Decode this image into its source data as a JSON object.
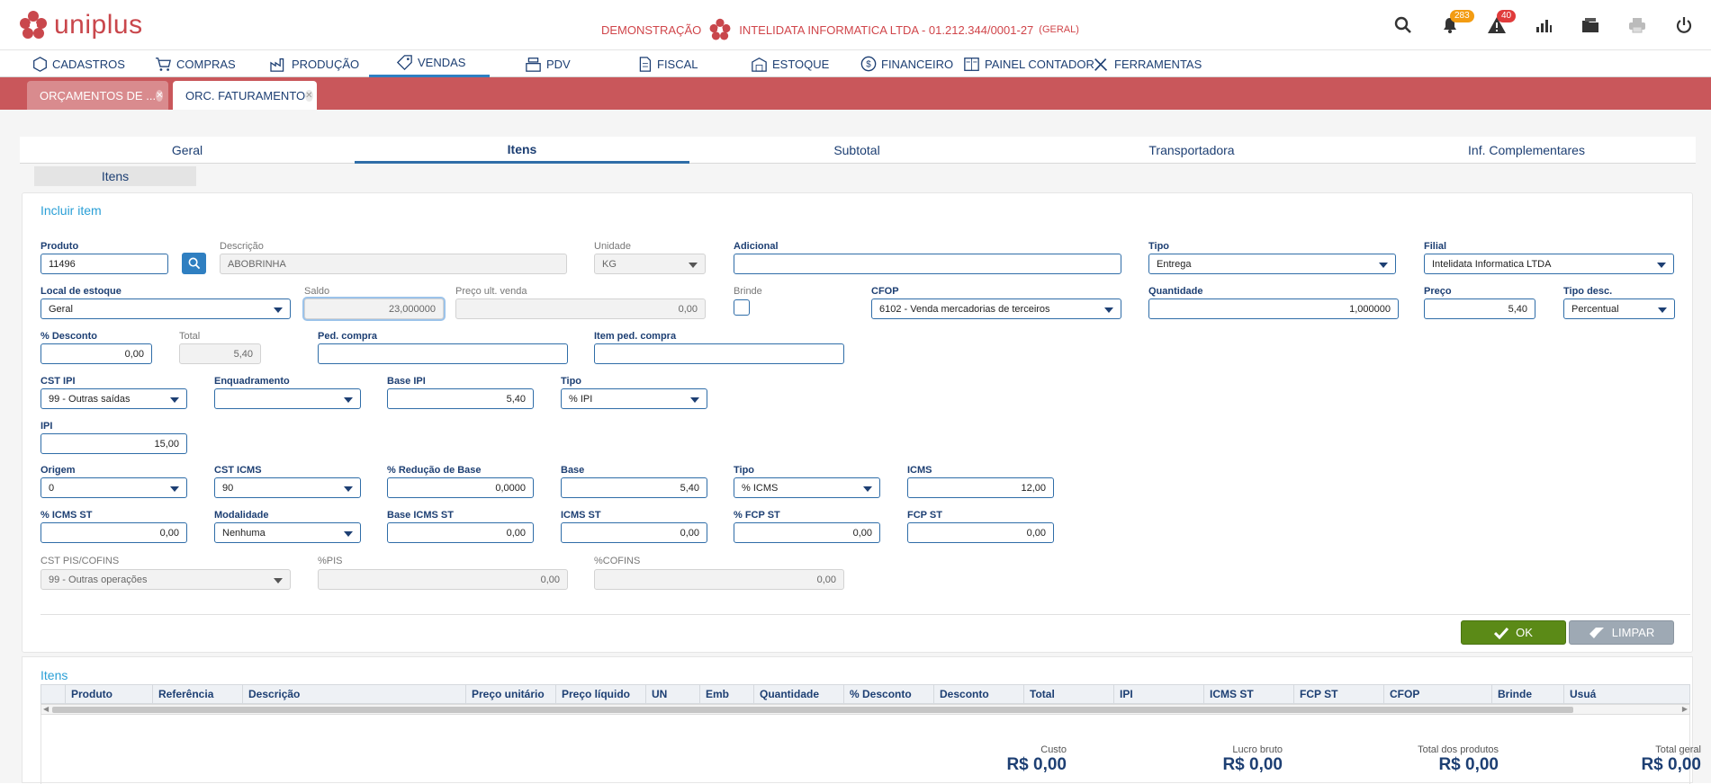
{
  "app": {
    "logo_text": "uniplus",
    "company_prefix": "DEMONSTRAÇÃO",
    "company_name": "INTELIDATA INFORMATICA LTDA - 01.212.344/0001-27",
    "company_suffix": "(GERAL)",
    "notifications_count": "283",
    "alerts_count": "40"
  },
  "menu": [
    "CADASTROS",
    "COMPRAS",
    "PRODUÇÃO",
    "VENDAS",
    "PDV",
    "FISCAL",
    "ESTOQUE",
    "FINANCEIRO",
    "PAINEL CONTADOR",
    "FERRAMENTAS"
  ],
  "doc_tabs": [
    "ORÇAMENTOS DE ...",
    "ORC. FATURAMENTO"
  ],
  "main_tabs": [
    "Geral",
    "Itens",
    "Subtotal",
    "Transportadora",
    "Inf. Complementares"
  ],
  "sub_tab": "Itens",
  "form": {
    "title": "Incluir item",
    "produto": {
      "label": "Produto",
      "value": "11496"
    },
    "descricao": {
      "label": "Descrição",
      "value": "ABOBRINHA"
    },
    "unidade": {
      "label": "Unidade",
      "value": "KG"
    },
    "adicional": {
      "label": "Adicional",
      "value": ""
    },
    "tipo": {
      "label": "Tipo",
      "value": "Entrega"
    },
    "filial": {
      "label": "Filial",
      "value": "Intelidata Informatica LTDA"
    },
    "local_estoque": {
      "label": "Local de estoque",
      "value": "Geral"
    },
    "saldo": {
      "label": "Saldo",
      "value": "23,000000"
    },
    "preco_ult_venda": {
      "label": "Preço ult. venda",
      "value": "0,00"
    },
    "brinde": {
      "label": "Brinde"
    },
    "cfop": {
      "label": "CFOP",
      "value": "6102 - Venda mercadorias de terceiros"
    },
    "quantidade": {
      "label": "Quantidade",
      "value": "1,000000"
    },
    "preco": {
      "label": "Preço",
      "value": "5,40"
    },
    "tipo_desc": {
      "label": "Tipo desc.",
      "value": "Percentual"
    },
    "desconto": {
      "label": "% Desconto",
      "value": "0,00"
    },
    "total": {
      "label": "Total",
      "value": "5,40"
    },
    "ped_compra": {
      "label": "Ped. compra",
      "value": ""
    },
    "item_ped_compra": {
      "label": "Item ped. compra",
      "value": ""
    },
    "cst_ipi": {
      "label": "CST IPI",
      "value": "99 - Outras saídas"
    },
    "enquadramento": {
      "label": "Enquadramento",
      "value": ""
    },
    "base_ipi": {
      "label": "Base IPI",
      "value": "5,40"
    },
    "tipo_ipi": {
      "label": "Tipo",
      "value": "% IPI"
    },
    "ipi": {
      "label": "IPI",
      "value": "15,00"
    },
    "origem": {
      "label": "Origem",
      "value": "0"
    },
    "cst_icms": {
      "label": "CST ICMS",
      "value": "90"
    },
    "reducao_base": {
      "label": "% Redução de Base",
      "value": "0,0000"
    },
    "base": {
      "label": "Base",
      "value": "5,40"
    },
    "tipo_icms": {
      "label": "Tipo",
      "value": "% ICMS"
    },
    "icms": {
      "label": "ICMS",
      "value": "12,00"
    },
    "icms_st_pct": {
      "label": "% ICMS ST",
      "value": "0,00"
    },
    "modalidade": {
      "label": "Modalidade",
      "value": "Nenhuma"
    },
    "base_icms_st": {
      "label": "Base ICMS ST",
      "value": "0,00"
    },
    "icms_st": {
      "label": "ICMS ST",
      "value": "0,00"
    },
    "fcp_st_pct": {
      "label": "% FCP ST",
      "value": "0,00"
    },
    "fcp_st": {
      "label": "FCP ST",
      "value": "0,00"
    },
    "cst_pis_cofins": {
      "label": "CST PIS/COFINS",
      "value": "99 - Outras operações"
    },
    "pis": {
      "label": "%PIS",
      "value": "0,00"
    },
    "cofins": {
      "label": "%COFINS",
      "value": "0,00"
    },
    "ok_label": "OK",
    "limpar_label": "LIMPAR"
  },
  "items": {
    "title": "Itens",
    "columns": [
      "Produto",
      "Referência",
      "Descrição",
      "Preço unitário",
      "Preço líquido",
      "UN",
      "Emb",
      "Quantidade",
      "% Desconto",
      "Desconto",
      "Total",
      "IPI",
      "ICMS ST",
      "FCP ST",
      "CFOP",
      "Brinde",
      "Usuá"
    ]
  },
  "summary": {
    "custo": {
      "label": "Custo",
      "value": "R$ 0,00"
    },
    "lucro": {
      "label": "Lucro bruto",
      "value": "R$ 0,00"
    },
    "total_produtos": {
      "label": "Total dos produtos",
      "value": "R$ 0,00"
    },
    "total_geral": {
      "label": "Total geral",
      "value": "R$ 0,00"
    }
  },
  "colors": {
    "brand": "#c9474c",
    "accent": "#2f7fc1",
    "navy": "#1d3f73",
    "ok": "#5b8a17"
  }
}
